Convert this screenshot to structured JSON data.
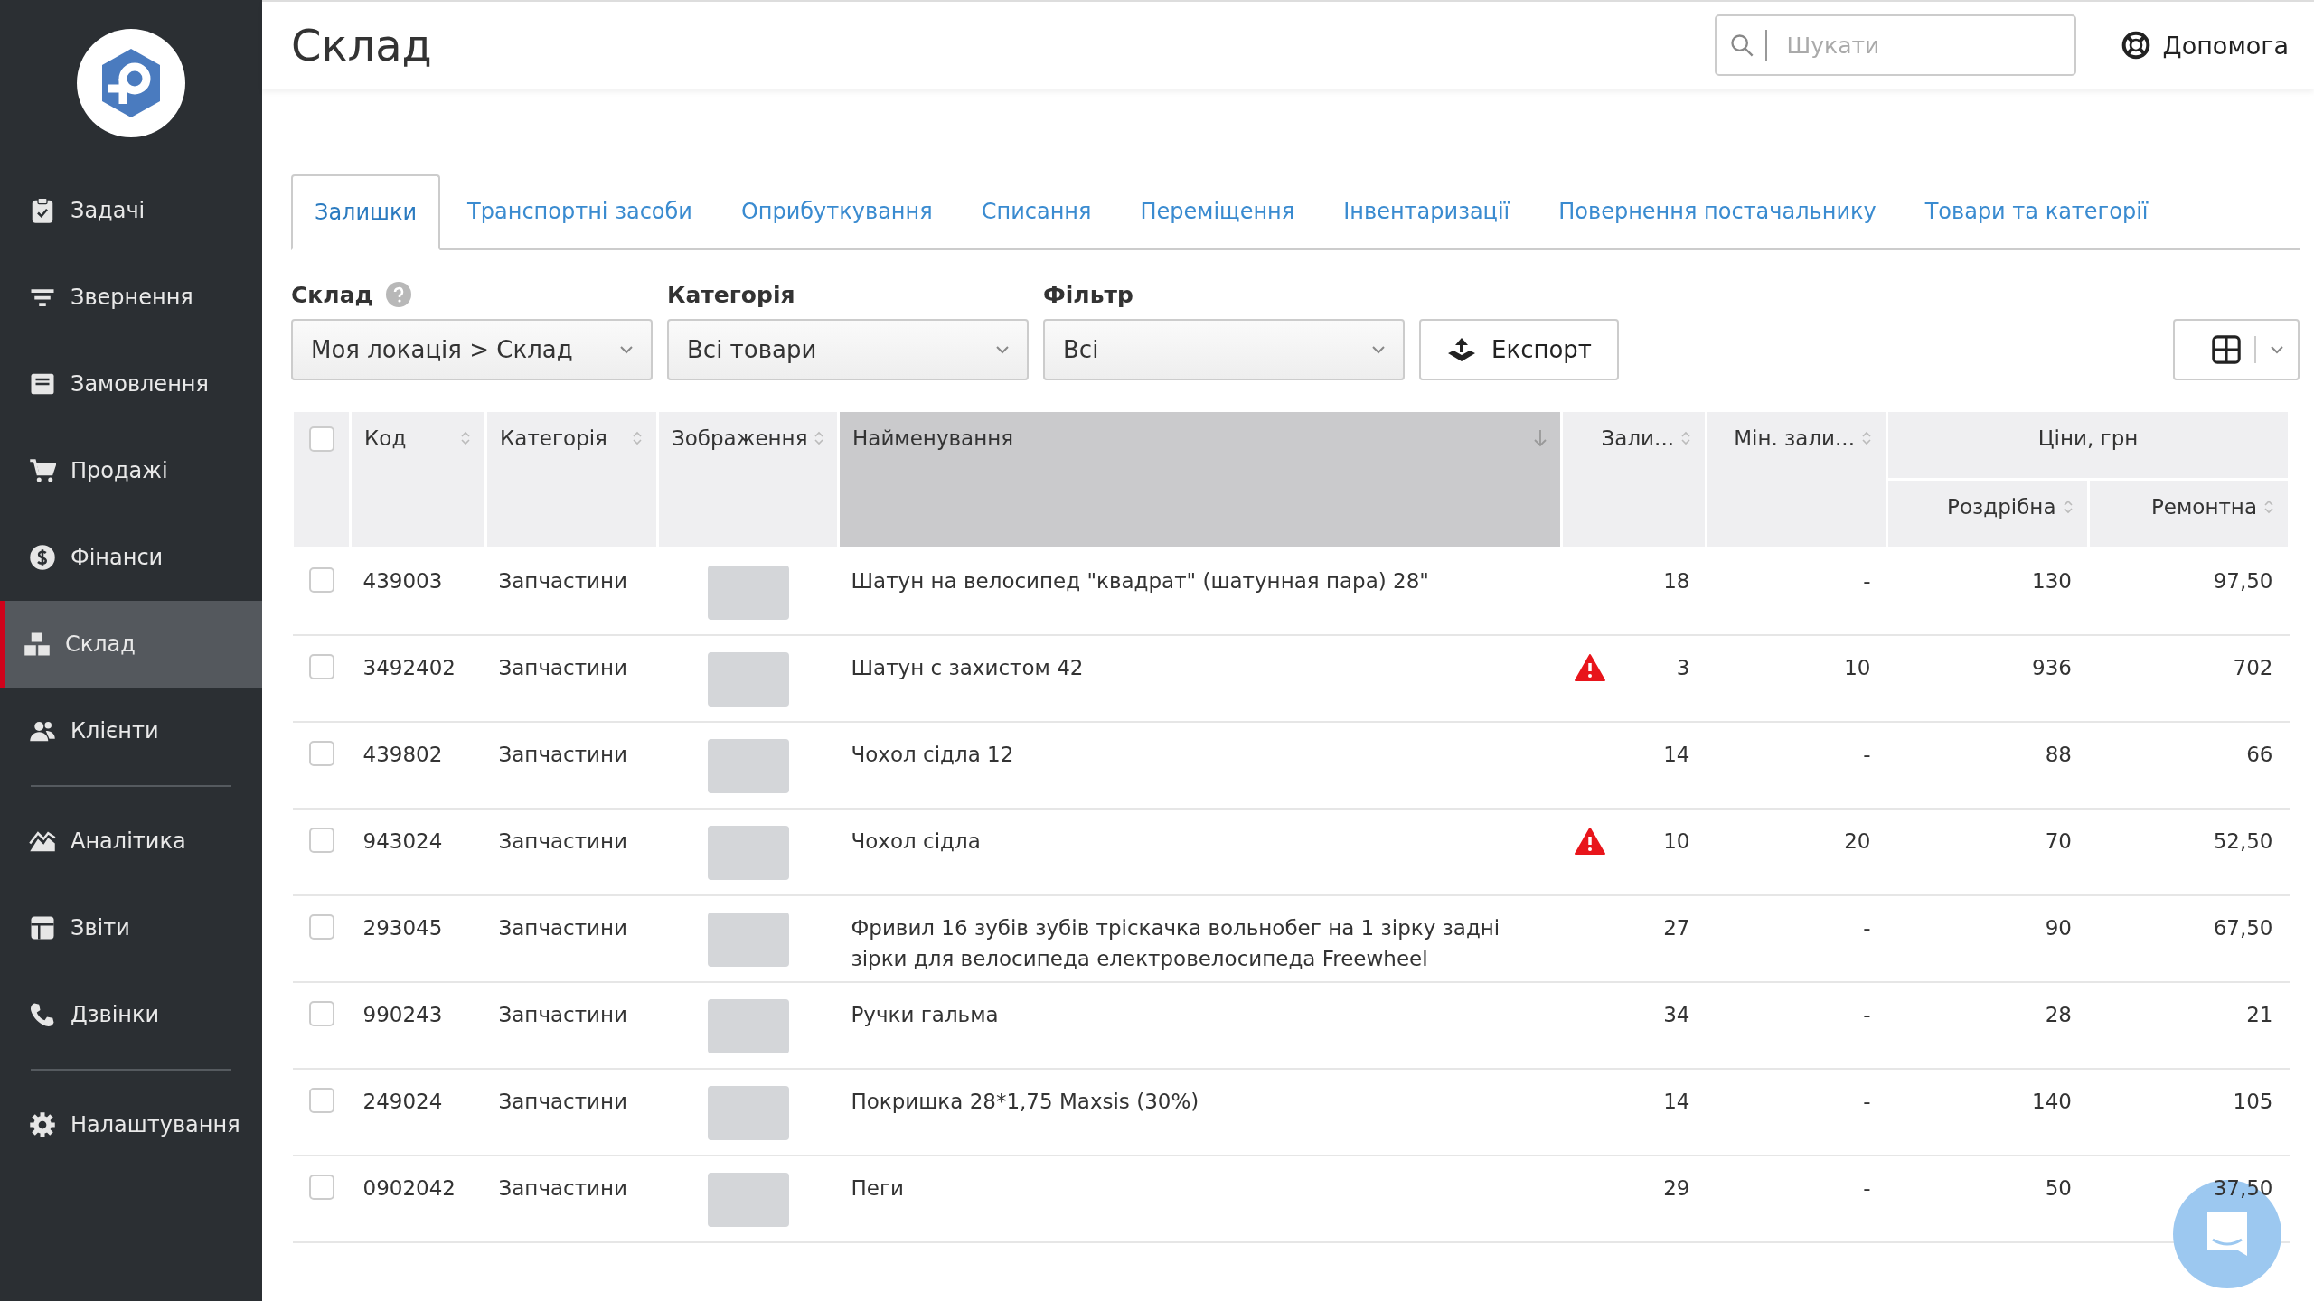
{
  "sidebar": {
    "groups": [
      [
        {
          "label": "Задачі",
          "selected": false
        },
        {
          "label": "Звернення",
          "selected": false
        },
        {
          "label": "Замовлення",
          "selected": false
        },
        {
          "label": "Продажі",
          "selected": false
        },
        {
          "label": "Фінанси",
          "selected": false
        },
        {
          "label": "Склад",
          "selected": true
        },
        {
          "label": "Клієнти",
          "selected": false
        }
      ],
      [
        {
          "label": "Аналітика",
          "selected": false
        },
        {
          "label": "Звіти",
          "selected": false
        },
        {
          "label": "Дзвінки",
          "selected": false
        }
      ],
      [
        {
          "label": "Налаштування",
          "selected": false
        }
      ]
    ]
  },
  "header": {
    "title": "Склад",
    "search": {
      "placeholder": "Шукати"
    },
    "help": "Допомога"
  },
  "tabs": [
    {
      "label": "Залишки",
      "selected": true
    },
    {
      "label": "Транспортні засоби",
      "selected": false
    },
    {
      "label": "Оприбуткування",
      "selected": false
    },
    {
      "label": "Списання",
      "selected": false
    },
    {
      "label": "Переміщення",
      "selected": false
    },
    {
      "label": "Інвентаризації",
      "selected": false
    },
    {
      "label": "Повернення постачальнику",
      "selected": false
    },
    {
      "label": "Товари та категорії",
      "selected": false
    }
  ],
  "filters": [
    {
      "label": "Склад",
      "help": true,
      "value": "Моя локація > Склад"
    },
    {
      "label": "Категорія",
      "help": false,
      "value": "Всі товари"
    },
    {
      "label": "Фільтр",
      "help": false,
      "value": "Всі"
    }
  ],
  "export_button": "Експорт",
  "table": {
    "select_all_checked": false,
    "columns": [
      {
        "label": "Код",
        "sorted": false
      },
      {
        "label": "Категорія",
        "sorted": false
      },
      {
        "label": "Зображення",
        "sorted": false
      },
      {
        "label": "Найменування",
        "sorted": true
      },
      {
        "label": "Зали...",
        "sorted": false
      },
      {
        "label": "Мін. зали...",
        "sorted": false
      }
    ],
    "price_group": {
      "label": "Ціни, грн",
      "columns": [
        {
          "label": "Роздрібна",
          "sorted": false
        },
        {
          "label": "Ремонтна",
          "sorted": false
        }
      ]
    },
    "rows": [
      {
        "checked": false,
        "code": "439003",
        "category": "Запчастини",
        "name": "Шатун на велосипед \"квадрат\" (шатунная пара) 28\"",
        "low_stock": false,
        "stock": "18",
        "min_stock": "-",
        "retail": "130",
        "repair": "97,50"
      },
      {
        "checked": false,
        "code": "3492402",
        "category": "Запчастини",
        "name": "Шатун с захистом 42",
        "low_stock": true,
        "stock": "3",
        "min_stock": "10",
        "retail": "936",
        "repair": "702"
      },
      {
        "checked": false,
        "code": "439802",
        "category": "Запчастини",
        "name": "Чохол сідла 12",
        "low_stock": false,
        "stock": "14",
        "min_stock": "-",
        "retail": "88",
        "repair": "66"
      },
      {
        "checked": false,
        "code": "943024",
        "category": "Запчастини",
        "name": "Чохол сідла",
        "low_stock": true,
        "stock": "10",
        "min_stock": "20",
        "retail": "70",
        "repair": "52,50"
      },
      {
        "checked": false,
        "code": "293045",
        "category": "Запчастини",
        "name": "Фривил 16 зубів зубів тріскачка вольнобег на 1 зірку задні зірки для велосипеда електровелосипеда Freewheel",
        "low_stock": false,
        "stock": "27",
        "min_stock": "-",
        "retail": "90",
        "repair": "67,50"
      },
      {
        "checked": false,
        "code": "990243",
        "category": "Запчастини",
        "name": "Ручки гальма",
        "low_stock": false,
        "stock": "34",
        "min_stock": "-",
        "retail": "28",
        "repair": "21"
      },
      {
        "checked": false,
        "code": "249024",
        "category": "Запчастини",
        "name": "Покришка 28*1,75 Maxsis (30%)",
        "low_stock": false,
        "stock": "14",
        "min_stock": "-",
        "retail": "140",
        "repair": "105"
      },
      {
        "checked": false,
        "code": "0902042",
        "category": "Запчастини",
        "name": "Пеги",
        "low_stock": false,
        "stock": "29",
        "min_stock": "-",
        "retail": "50",
        "repair": "37,50"
      }
    ]
  }
}
